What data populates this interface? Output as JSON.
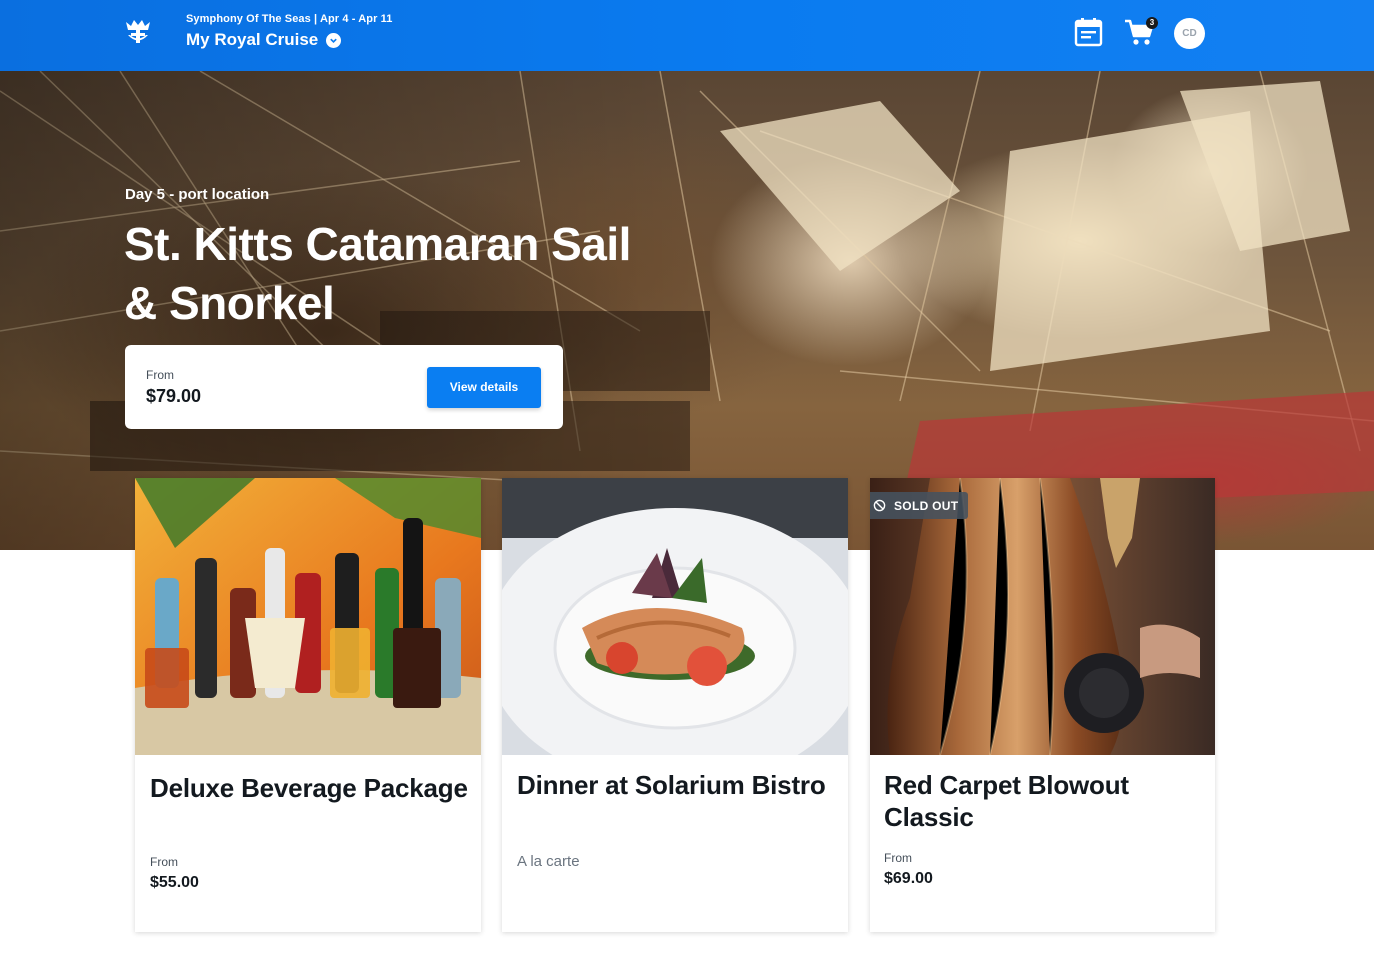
{
  "header": {
    "voyage_subtitle": "Symphony Of The Seas | Apr 4 - Apr 11",
    "voyage_title": "My Royal Cruise",
    "cart_count": "3",
    "avatar_initials": "CD",
    "icons": [
      "royal-caribbean-crown-logo",
      "itinerary-icon",
      "cart-icon",
      "chevron-down-icon"
    ]
  },
  "hero": {
    "kicker": "Day 5 - port location",
    "title": "St. Kitts Catamaran Sail & Snorkel",
    "price_label": "From",
    "price": "$79.00",
    "cta_label": "View details"
  },
  "cards": [
    {
      "title": "Deluxe Beverage Package",
      "price_label": "From",
      "price": "$55.00"
    },
    {
      "title": "Dinner at Solarium Bistro",
      "subtitle": "A la carte"
    },
    {
      "badge": "SOLD OUT",
      "title": "Red Carpet Blowout Classic",
      "price_label": "From",
      "price": "$69.00"
    }
  ],
  "colors": {
    "header_blue": "#0a7bf0",
    "button_blue": "#0a7ef2",
    "text_dark": "#13191f",
    "sold_out_badge": "#46525e"
  }
}
